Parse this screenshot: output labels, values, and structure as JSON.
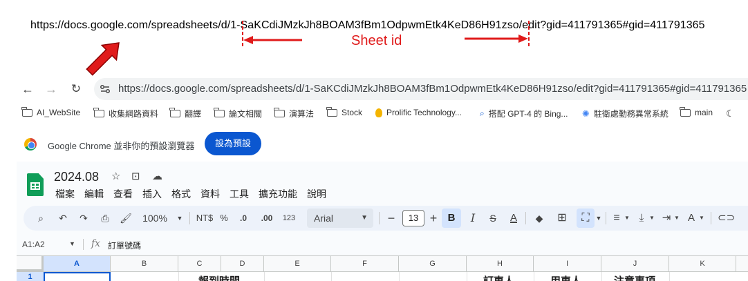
{
  "annotation": {
    "url": "https://docs.google.com/spreadsheets/d/1-SaKCdiJMzkJh8BOAM3fBm1OdpwmEtk4KeD86H91zso/edit?gid=411791365#gid=411791365",
    "label": "Sheet id",
    "colors": {
      "accent": "#e01b1b"
    }
  },
  "browser": {
    "url": "https://docs.google.com/spreadsheets/d/1-SaKCdiJMzkJh8BOAM3fBm1OdpwmEtk4KeD86H91zso/edit?gid=411791365#gid=411791365",
    "bookmarks": [
      {
        "label": "AI_WebSite",
        "icon": "folder-icon"
      },
      {
        "label": "收集網路資料",
        "icon": "folder-icon"
      },
      {
        "label": "翻譯",
        "icon": "folder-icon"
      },
      {
        "label": "論文相關",
        "icon": "folder-icon"
      },
      {
        "label": "演算法",
        "icon": "folder-icon"
      },
      {
        "label": "Stock",
        "icon": "folder-icon"
      },
      {
        "label": "Prolific Technology...",
        "icon": "bulb-icon"
      },
      {
        "label": "搭配 GPT-4 的 Bing...",
        "icon": "search-icon"
      },
      {
        "label": "駐衛處勤務異常系統",
        "icon": "app-icon"
      },
      {
        "label": "main",
        "icon": "folder-icon"
      }
    ],
    "infobar": {
      "text": "Google Chrome 並非你的預設瀏覽器",
      "button": "設為預設"
    }
  },
  "sheet": {
    "title": "2024.08",
    "menus": [
      "檔案",
      "編輯",
      "查看",
      "插入",
      "格式",
      "資料",
      "工具",
      "擴充功能",
      "說明"
    ],
    "toolbar": {
      "zoom": "100%",
      "currency": "NT$",
      "percent": "%",
      "dec_decrease": ".0",
      "dec_increase": ".00",
      "number_format": "123",
      "font": "Arial",
      "font_size": "13"
    },
    "name_box": "A1:A2",
    "formula": "訂單號碼",
    "columns": [
      "A",
      "B",
      "C",
      "D",
      "E",
      "F",
      "G",
      "H",
      "I",
      "J",
      "K"
    ],
    "row1": {
      "number": "1",
      "c": "報到時間",
      "h": "訂車人",
      "i": "用車人",
      "j": "注意事項"
    }
  }
}
